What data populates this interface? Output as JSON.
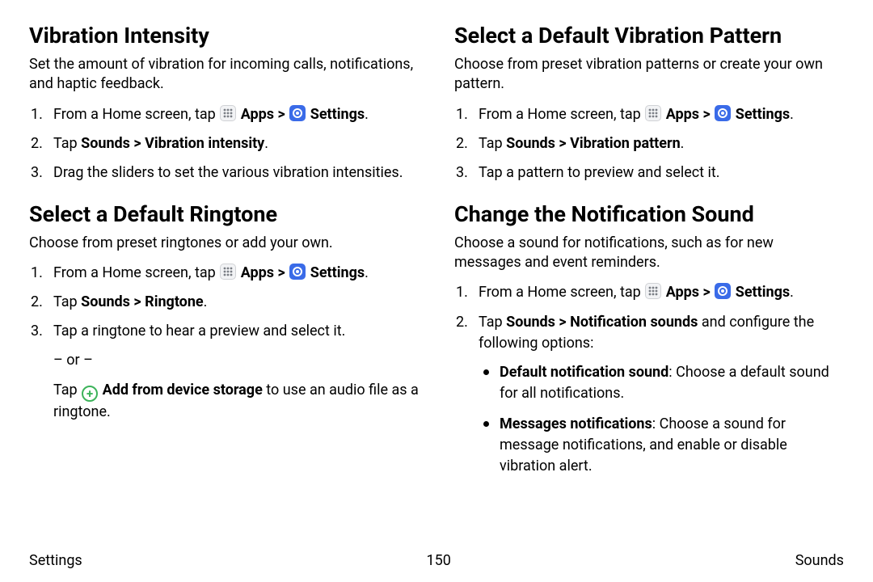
{
  "left": {
    "section1": {
      "title": "Vibration Intensity",
      "intro": "Set the amount of vibration for incoming calls, notifications, and haptic feedback.",
      "step1_prefix": "From a Home screen, tap ",
      "apps_label": "Apps",
      "chevron": " > ",
      "settings_label": "Settings",
      "period": ".",
      "step2_prefix": "Tap ",
      "step2_bold": "Sounds > Vibration intensity",
      "step3": "Drag the sliders to set the various vibration intensities."
    },
    "section2": {
      "title": "Select a Default Ringtone",
      "intro": "Choose from preset ringtones or add your own.",
      "step1_prefix": "From a Home screen, tap ",
      "apps_label": "Apps",
      "chevron": " > ",
      "settings_label": "Settings",
      "period": ".",
      "step2_prefix": "Tap ",
      "step2_bold": "Sounds > Ringtone",
      "step3": "Tap a ringtone to hear a preview and select it.",
      "or_text": "– or –",
      "step3b_prefix": "Tap ",
      "step3b_bold": "Add from device storage",
      "step3b_suffix": " to use an audio file as a ringtone."
    }
  },
  "right": {
    "section1": {
      "title": "Select a Default Vibration Pattern",
      "intro": "Choose from preset vibration patterns or create your own pattern.",
      "step1_prefix": "From a Home screen, tap ",
      "apps_label": "Apps",
      "chevron": " > ",
      "settings_label": "Settings",
      "period": ".",
      "step2_prefix": "Tap ",
      "step2_bold": "Sounds > Vibration pattern",
      "step3": "Tap a pattern to preview and select it."
    },
    "section2": {
      "title": "Change the Notification Sound",
      "intro": "Choose a sound for notifications, such as for new messages and event reminders.",
      "step1_prefix": "From a Home screen, tap ",
      "apps_label": "Apps",
      "chevron": " > ",
      "settings_label": "Settings",
      "period": ".",
      "step2_prefix": "Tap ",
      "step2_bold": "Sounds > Notification sounds",
      "step2_suffix": " and configure the following options:",
      "bullet1_bold": "Default notification sound",
      "bullet1_rest": ": Choose a default sound for all notifications.",
      "bullet2_bold": "Messages notifications",
      "bullet2_rest": ": Choose a sound for message notifications, and enable or disable vibration alert."
    }
  },
  "footer": {
    "left": "Settings",
    "center": "150",
    "right": "Sounds"
  },
  "icons": {
    "apps": "apps-icon",
    "settings": "settings-icon",
    "add": "add-icon"
  }
}
